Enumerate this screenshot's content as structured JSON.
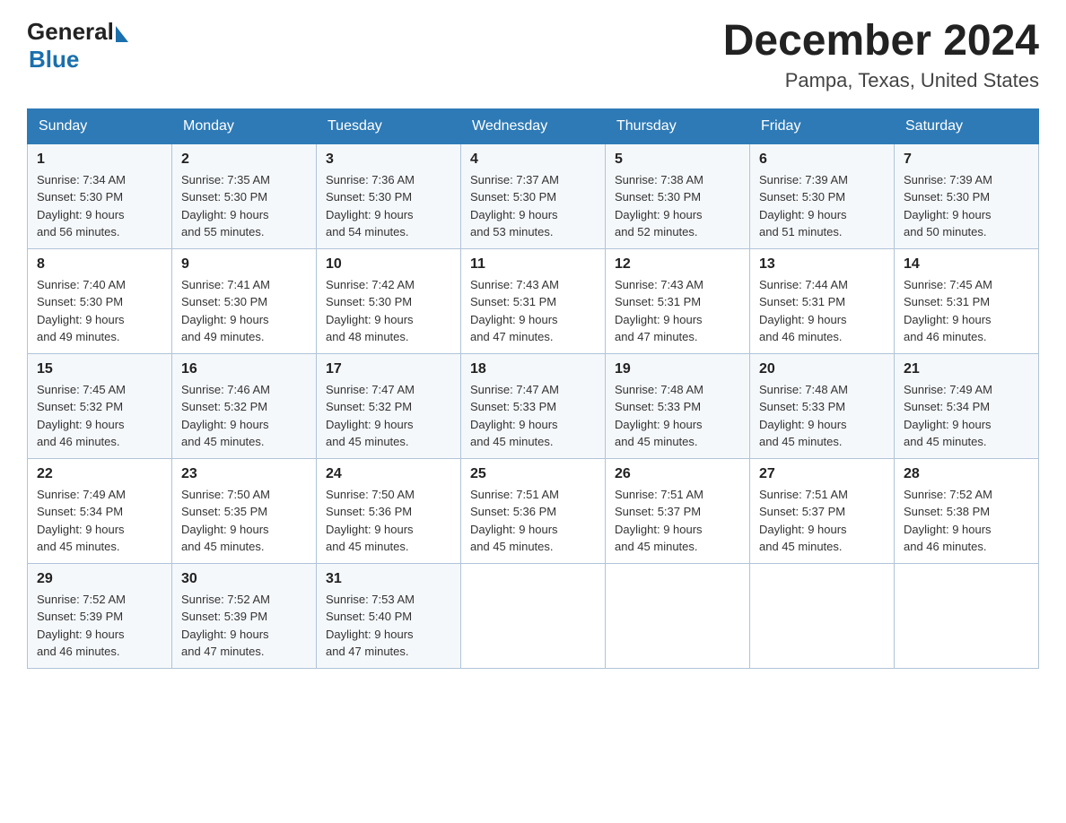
{
  "header": {
    "logo_general": "General",
    "logo_blue": "Blue",
    "title": "December 2024",
    "subtitle": "Pampa, Texas, United States"
  },
  "calendar": {
    "days_of_week": [
      "Sunday",
      "Monday",
      "Tuesday",
      "Wednesday",
      "Thursday",
      "Friday",
      "Saturday"
    ],
    "weeks": [
      [
        {
          "day": "1",
          "sunrise": "7:34 AM",
          "sunset": "5:30 PM",
          "daylight": "9 hours and 56 minutes."
        },
        {
          "day": "2",
          "sunrise": "7:35 AM",
          "sunset": "5:30 PM",
          "daylight": "9 hours and 55 minutes."
        },
        {
          "day": "3",
          "sunrise": "7:36 AM",
          "sunset": "5:30 PM",
          "daylight": "9 hours and 54 minutes."
        },
        {
          "day": "4",
          "sunrise": "7:37 AM",
          "sunset": "5:30 PM",
          "daylight": "9 hours and 53 minutes."
        },
        {
          "day": "5",
          "sunrise": "7:38 AM",
          "sunset": "5:30 PM",
          "daylight": "9 hours and 52 minutes."
        },
        {
          "day": "6",
          "sunrise": "7:39 AM",
          "sunset": "5:30 PM",
          "daylight": "9 hours and 51 minutes."
        },
        {
          "day": "7",
          "sunrise": "7:39 AM",
          "sunset": "5:30 PM",
          "daylight": "9 hours and 50 minutes."
        }
      ],
      [
        {
          "day": "8",
          "sunrise": "7:40 AM",
          "sunset": "5:30 PM",
          "daylight": "9 hours and 49 minutes."
        },
        {
          "day": "9",
          "sunrise": "7:41 AM",
          "sunset": "5:30 PM",
          "daylight": "9 hours and 49 minutes."
        },
        {
          "day": "10",
          "sunrise": "7:42 AM",
          "sunset": "5:30 PM",
          "daylight": "9 hours and 48 minutes."
        },
        {
          "day": "11",
          "sunrise": "7:43 AM",
          "sunset": "5:31 PM",
          "daylight": "9 hours and 47 minutes."
        },
        {
          "day": "12",
          "sunrise": "7:43 AM",
          "sunset": "5:31 PM",
          "daylight": "9 hours and 47 minutes."
        },
        {
          "day": "13",
          "sunrise": "7:44 AM",
          "sunset": "5:31 PM",
          "daylight": "9 hours and 46 minutes."
        },
        {
          "day": "14",
          "sunrise": "7:45 AM",
          "sunset": "5:31 PM",
          "daylight": "9 hours and 46 minutes."
        }
      ],
      [
        {
          "day": "15",
          "sunrise": "7:45 AM",
          "sunset": "5:32 PM",
          "daylight": "9 hours and 46 minutes."
        },
        {
          "day": "16",
          "sunrise": "7:46 AM",
          "sunset": "5:32 PM",
          "daylight": "9 hours and 45 minutes."
        },
        {
          "day": "17",
          "sunrise": "7:47 AM",
          "sunset": "5:32 PM",
          "daylight": "9 hours and 45 minutes."
        },
        {
          "day": "18",
          "sunrise": "7:47 AM",
          "sunset": "5:33 PM",
          "daylight": "9 hours and 45 minutes."
        },
        {
          "day": "19",
          "sunrise": "7:48 AM",
          "sunset": "5:33 PM",
          "daylight": "9 hours and 45 minutes."
        },
        {
          "day": "20",
          "sunrise": "7:48 AM",
          "sunset": "5:33 PM",
          "daylight": "9 hours and 45 minutes."
        },
        {
          "day": "21",
          "sunrise": "7:49 AM",
          "sunset": "5:34 PM",
          "daylight": "9 hours and 45 minutes."
        }
      ],
      [
        {
          "day": "22",
          "sunrise": "7:49 AM",
          "sunset": "5:34 PM",
          "daylight": "9 hours and 45 minutes."
        },
        {
          "day": "23",
          "sunrise": "7:50 AM",
          "sunset": "5:35 PM",
          "daylight": "9 hours and 45 minutes."
        },
        {
          "day": "24",
          "sunrise": "7:50 AM",
          "sunset": "5:36 PM",
          "daylight": "9 hours and 45 minutes."
        },
        {
          "day": "25",
          "sunrise": "7:51 AM",
          "sunset": "5:36 PM",
          "daylight": "9 hours and 45 minutes."
        },
        {
          "day": "26",
          "sunrise": "7:51 AM",
          "sunset": "5:37 PM",
          "daylight": "9 hours and 45 minutes."
        },
        {
          "day": "27",
          "sunrise": "7:51 AM",
          "sunset": "5:37 PM",
          "daylight": "9 hours and 45 minutes."
        },
        {
          "day": "28",
          "sunrise": "7:52 AM",
          "sunset": "5:38 PM",
          "daylight": "9 hours and 46 minutes."
        }
      ],
      [
        {
          "day": "29",
          "sunrise": "7:52 AM",
          "sunset": "5:39 PM",
          "daylight": "9 hours and 46 minutes."
        },
        {
          "day": "30",
          "sunrise": "7:52 AM",
          "sunset": "5:39 PM",
          "daylight": "9 hours and 47 minutes."
        },
        {
          "day": "31",
          "sunrise": "7:53 AM",
          "sunset": "5:40 PM",
          "daylight": "9 hours and 47 minutes."
        },
        null,
        null,
        null,
        null
      ]
    ],
    "labels": {
      "sunrise": "Sunrise: ",
      "sunset": "Sunset: ",
      "daylight": "Daylight: "
    }
  }
}
